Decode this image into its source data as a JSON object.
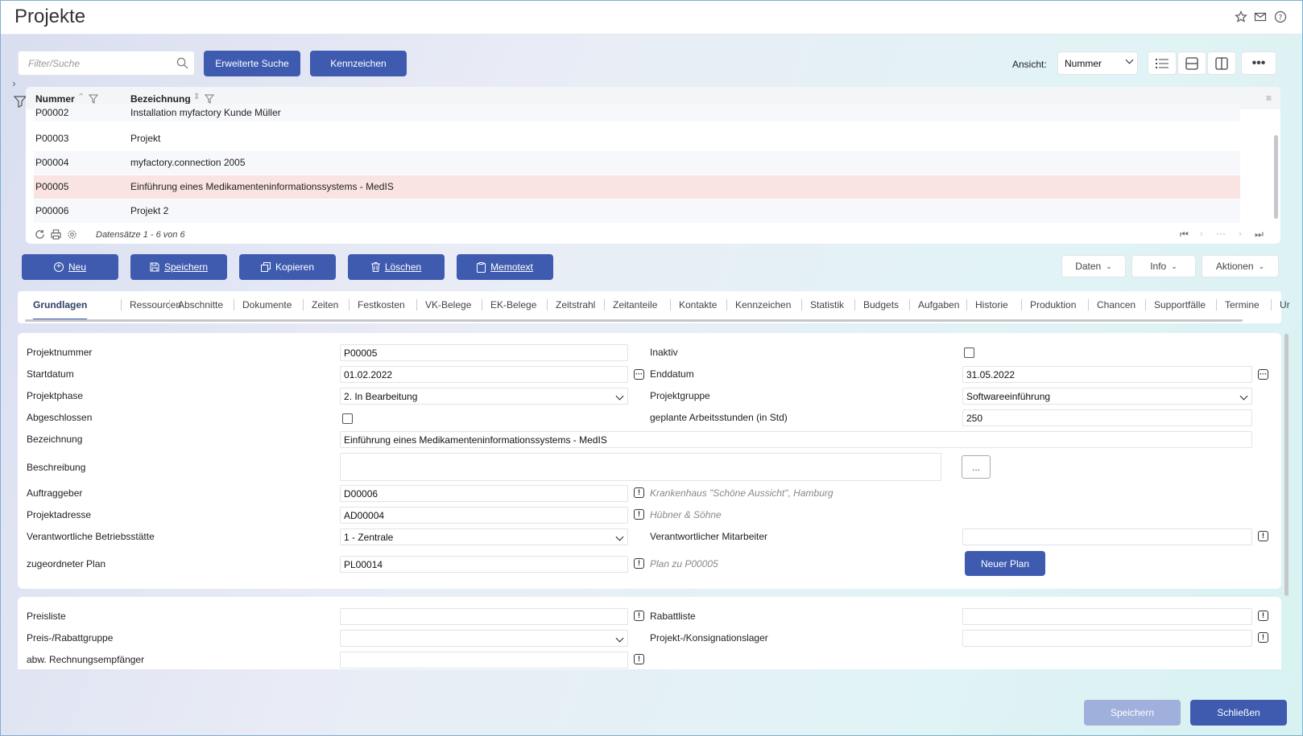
{
  "title": "Projekte",
  "search": {
    "placeholder": "Filter/Suche"
  },
  "toolbar": {
    "extended_search": "Erweiterte Suche",
    "tags": "Kennzeichen",
    "view_label": "Ansicht:",
    "view_value": "Nummer"
  },
  "grid": {
    "col_number": "Nummer",
    "col_name": "Bezeichnung",
    "rows": [
      [
        "P00002",
        "Installation myfactory Kunde Müller"
      ],
      [
        "P00003",
        "Projekt"
      ],
      [
        "P00004",
        "myfactory.connection 2005"
      ],
      [
        "P00005",
        "Einführung eines Medikamenteninformationssystems - MedIS"
      ],
      [
        "P00006",
        "Projekt 2"
      ]
    ],
    "selected_row": 3,
    "records": "Datensätze 1 - 6 von 6"
  },
  "actions": {
    "new": "Neu",
    "save": "Speichern",
    "copy": "Kopieren",
    "delete": "Löschen",
    "memo": "Memotext",
    "data": "Daten",
    "info": "Info",
    "actions": "Aktionen"
  },
  "tabs": [
    "Grundlagen",
    "Ressourcen",
    "Abschnitte",
    "Dokumente",
    "Zeiten",
    "Festkosten",
    "VK-Belege",
    "EK-Belege",
    "Zeitstrahl",
    "Zeitanteile",
    "Kontakte",
    "Kennzeichen",
    "Statistik",
    "Budgets",
    "Aufgaben",
    "Historie",
    "Produktion",
    "Chancen",
    "Supportfälle",
    "Termine",
    "Ur"
  ],
  "form": {
    "project_number_label": "Projektnummer",
    "project_number": "P00005",
    "inactive_label": "Inaktiv",
    "start_label": "Startdatum",
    "start": "01.02.2022",
    "end_label": "Enddatum",
    "end": "31.05.2022",
    "phase_label": "Projektphase",
    "phase": "2. In Bearbeitung",
    "group_label": "Projektgruppe",
    "group": "Softwareeinführung",
    "closed_label": "Abgeschlossen",
    "hours_label": "geplante Arbeitsstunden (in Std)",
    "hours": "250",
    "name_label": "Bezeichnung",
    "name": "Einführung eines Medikamenteninformationssystems - MedIS",
    "desc_label": "Beschreibung",
    "desc_btn": "...",
    "client_label": "Auftraggeber",
    "client": "D00006",
    "client_hint": "Krankenhaus \"Schöne Aussicht\", Hamburg",
    "address_label": "Projektadresse",
    "address": "AD00004",
    "address_hint": "Hübner & Söhne",
    "site_label": "Verantwortliche Betriebsstätte",
    "site": "1 - Zentrale",
    "employee_label": "Verantwortlicher Mitarbeiter",
    "employee": "",
    "plan_label": "zugeordneter Plan",
    "plan": "PL00014",
    "plan_hint": "Plan zu P00005",
    "new_plan": "Neuer Plan",
    "pricelist_label": "Preisliste",
    "discount_label": "Rabattliste",
    "pricegroup_label": "Preis-/Rabattgruppe",
    "stock_label": "Projekt-/Konsignationslager",
    "invoice_label": "abw. Rechnungsempfänger"
  },
  "footer": {
    "save": "Speichern",
    "close": "Schließen"
  }
}
